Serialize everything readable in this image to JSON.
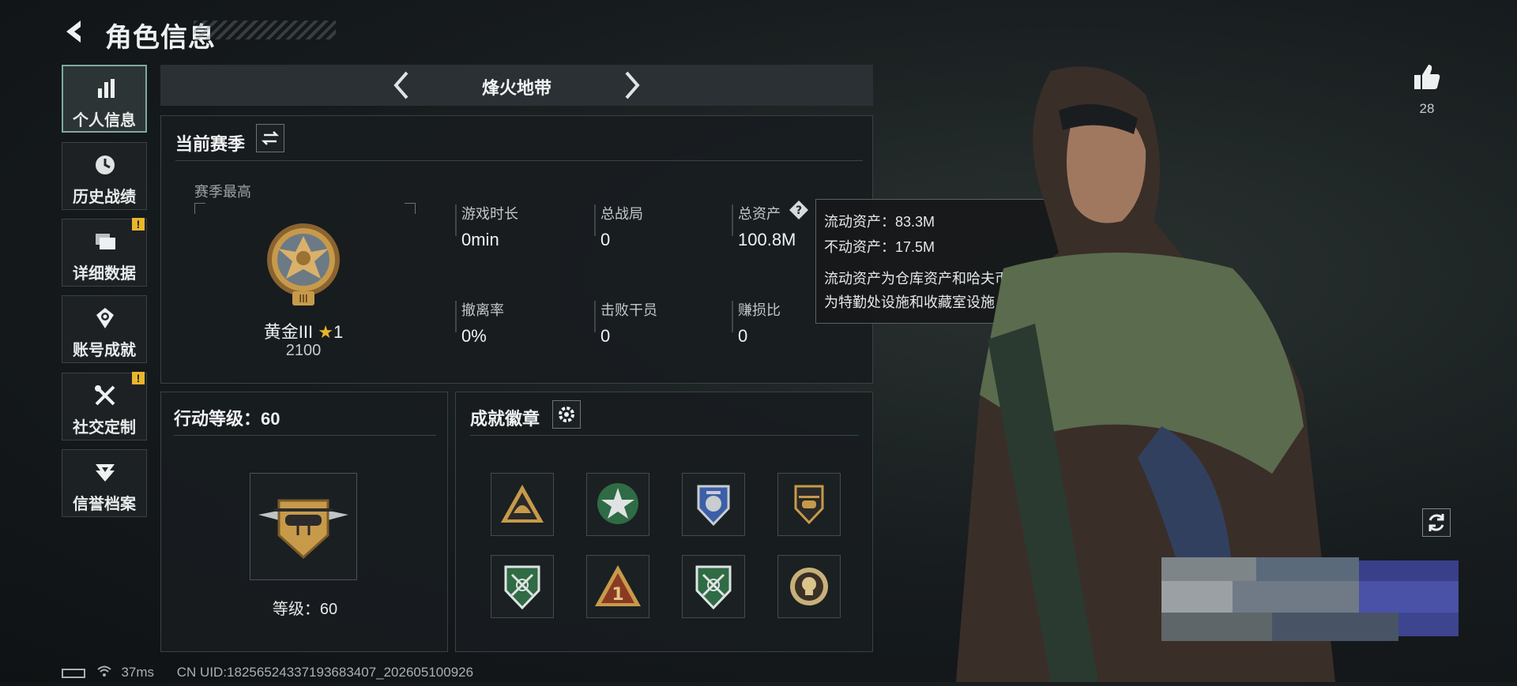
{
  "header": {
    "title": "角色信息",
    "back_icon": "back-arrow-icon"
  },
  "sidebar": {
    "items": [
      {
        "label": "个人信息",
        "icon": "bar-chart-icon",
        "active": true,
        "alert": false
      },
      {
        "label": "历史战绩",
        "icon": "clock-icon",
        "active": false,
        "alert": false
      },
      {
        "label": "详细数据",
        "icon": "folder-icon",
        "active": false,
        "alert": true
      },
      {
        "label": "账号成就",
        "icon": "trophy-icon",
        "active": false,
        "alert": false
      },
      {
        "label": "社交定制",
        "icon": "tools-icon",
        "active": false,
        "alert": true
      },
      {
        "label": "信誉档案",
        "icon": "reputation-icon",
        "active": false,
        "alert": false
      }
    ],
    "alert_mark": "!"
  },
  "mode_selector": {
    "name": "烽火地带"
  },
  "season": {
    "title": "当前赛季",
    "best_label": "赛季最高",
    "rank_name": "黄金III",
    "rank_stars": "1",
    "rank_points": "2100",
    "stats": [
      {
        "label": "游戏时长",
        "value": "0min"
      },
      {
        "label": "总战局",
        "value": "0"
      },
      {
        "label": "总资产",
        "value": "100.8M"
      },
      {
        "label": "撤离率",
        "value": "0%"
      },
      {
        "label": "击败干员",
        "value": "0"
      },
      {
        "label": "赚损比",
        "value": "0"
      }
    ]
  },
  "tooltip": {
    "liquid": "流动资产：83.3M",
    "fixed": "不动资产：17.5M",
    "desc_line1": "流动资产为仓库资产和哈夫币，不动资产",
    "desc_line2": "为特勤处设施和收藏室设施"
  },
  "action_level": {
    "title": "行动等级：60",
    "level_text": "等级：60"
  },
  "achievements": {
    "title": "成就徽章",
    "badges": [
      "helmet-triangle-badge",
      "star-shield-badge",
      "winged-shield-badge",
      "helicopter-badge",
      "crossed-rifles-shield-badge",
      "number-one-triangle-badge",
      "crossed-rifles-shield-badge",
      "skull-medal-badge"
    ]
  },
  "footer": {
    "ping": "37ms",
    "uid": "CN UID:18256524337193683407_202605100926"
  },
  "likes": {
    "count": "28"
  },
  "colors": {
    "accent": "#7fa9a0",
    "alert": "#e8b62c",
    "panel": "#181c1f",
    "gold": "#c79a4a"
  }
}
